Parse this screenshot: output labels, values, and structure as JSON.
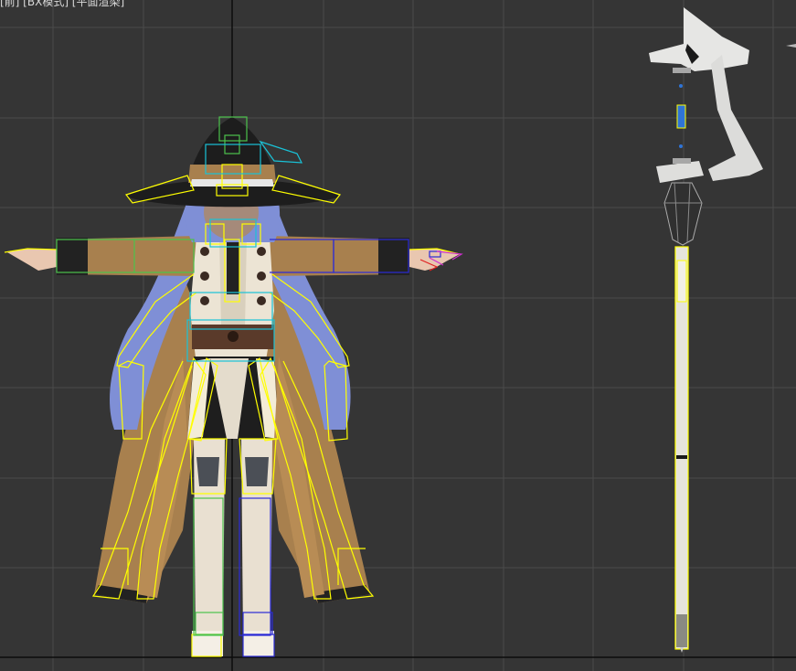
{
  "viewport": {
    "label": "[前] [ВХ模式] [平面渲染]",
    "view": "front",
    "grid_visible": true,
    "colors": {
      "background": "#353535",
      "grid": "#4a4a4a",
      "axis": "#0a0a0a",
      "bone_yellow": "#ffff00",
      "bone_green": "#4cc24c",
      "bone_blue": "#2b2bd6",
      "bone_cyan": "#19c3d8",
      "bone_magenta": "#d02fd0"
    }
  },
  "scene": {
    "objects": [
      {
        "id": "character",
        "icon": "character-mesh-icon"
      },
      {
        "id": "staff",
        "icon": "staff-mesh-icon"
      }
    ]
  }
}
